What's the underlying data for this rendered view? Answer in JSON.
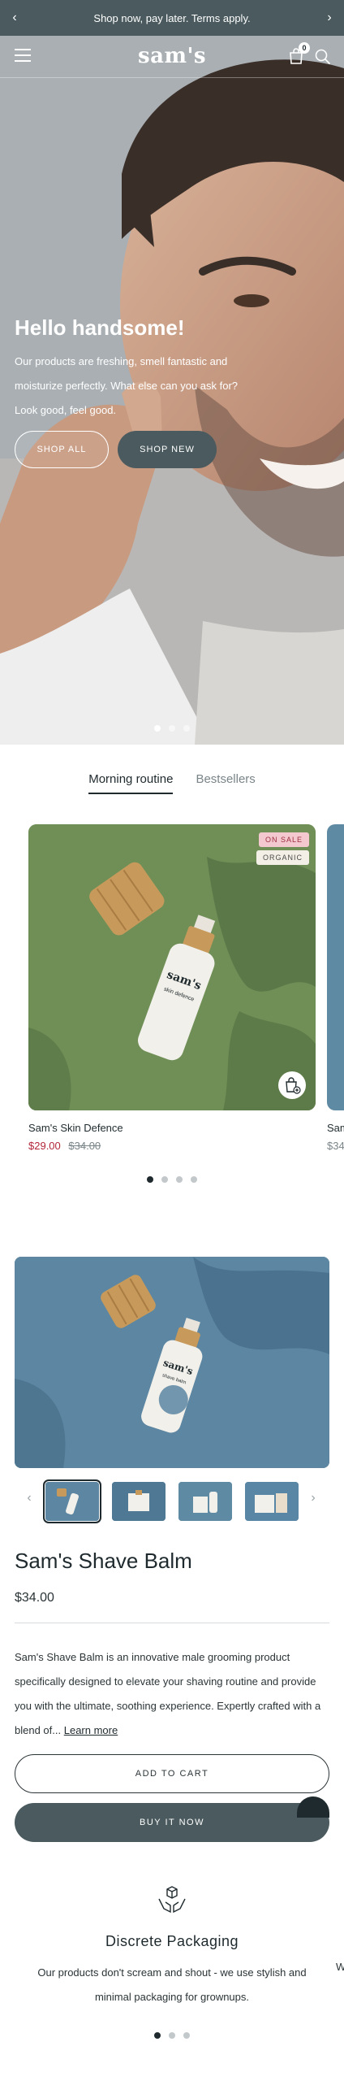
{
  "announcement": {
    "text": "Shop now, pay later. Terms apply."
  },
  "header": {
    "logo": "sam's",
    "cart_count": "0"
  },
  "hero": {
    "title": "Hello handsome!",
    "text": "Our products are freshing, smell fantastic and moisturize perfectly. What else can you ask for? Look good, feel good.",
    "shop_all": "SHOP ALL",
    "shop_new": "SHOP NEW",
    "slide_count": 3,
    "active_slide": 1
  },
  "tabs": [
    {
      "label": "Morning routine",
      "active": true
    },
    {
      "label": "Bestsellers",
      "active": false
    }
  ],
  "product_carousel": {
    "items": [
      {
        "name": "Sam's Skin Defence",
        "price": "$29.00",
        "compare_price": "$34.00",
        "badges": [
          "ON SALE",
          "ORGANIC"
        ],
        "bottle_label": "sam's",
        "bottle_sublabel": "skin defence"
      },
      {
        "name": "Sam",
        "price": "$34"
      }
    ],
    "page_count": 4,
    "active_page": 1
  },
  "featured": {
    "title": "Sam's Shave Balm",
    "price": "$34.00",
    "description": "Sam's Shave Balm is an innovative male grooming product specifically designed to elevate your shaving routine and provide you with the ultimate, soothing experience. Expertly crafted with a blend of...",
    "learn_more": "Learn more",
    "add_to_cart": "ADD TO CART",
    "buy_now": "BUY IT NOW",
    "bottle_label": "sam's",
    "bottle_sublabel": "shave balm",
    "thumbnail_count": 4,
    "active_thumbnail": 1
  },
  "feature": {
    "title": "Discrete Packaging",
    "text": "Our products don't scream and shout - we use stylish and minimal packaging for grownups.",
    "next_peek": "W",
    "slide_count": 3,
    "active_slide": 1
  },
  "icons": {
    "announce_prev": "chevron-left-icon",
    "announce_next": "chevron-right-icon",
    "menu": "hamburger-icon",
    "cart": "shopping-bag-icon",
    "search": "search-icon",
    "quick_add": "add-to-bag-icon",
    "feature": "hands-box-icon"
  },
  "colors": {
    "primary": "#4a5a5e",
    "sale": "#b3263a",
    "badge_sale_bg": "#f3c8cf",
    "card_green": "#6f8f57",
    "product_blue": "#5c86a2"
  }
}
